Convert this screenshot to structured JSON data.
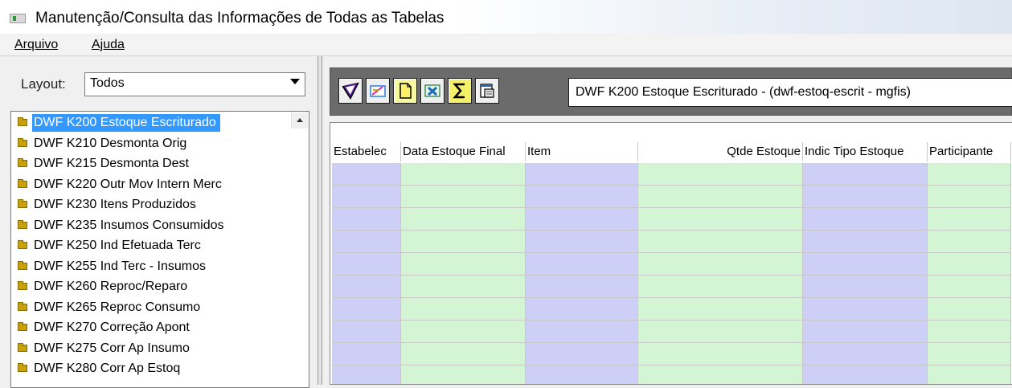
{
  "window": {
    "title": "Manutenção/Consulta das Informações de Todas as Tabelas"
  },
  "menu": {
    "items": [
      {
        "label": "Arquivo"
      },
      {
        "label": "Ajuda"
      }
    ]
  },
  "left": {
    "layout_label": "Layout:",
    "layout_value": "Todos",
    "tables": [
      {
        "label": "DWF K200 Estoque Escriturado",
        "selected": true
      },
      {
        "label": "DWF K210 Desmonta Orig"
      },
      {
        "label": "DWF K215 Desmonta Dest"
      },
      {
        "label": "DWF K220 Outr Mov Intern Merc"
      },
      {
        "label": "DWF K230 Itens Produzidos"
      },
      {
        "label": "DWF K235 Insumos Consumidos"
      },
      {
        "label": "DWF K250 Ind Efetuada Terc"
      },
      {
        "label": "DWF K255 Ind Terc - Insumos"
      },
      {
        "label": "DWF K260 Reproc/Reparo"
      },
      {
        "label": "DWF K265 Reproc Consumo"
      },
      {
        "label": "DWF K270 Correção Apont"
      },
      {
        "label": "DWF K275 Corr Ap Insumo"
      },
      {
        "label": "DWF K280 Corr Ap Estoq"
      }
    ]
  },
  "toolbar": {
    "icons": [
      "filter-icon",
      "edit-icon",
      "new-document-icon",
      "excel-export-icon",
      "sum-icon",
      "properties-icon"
    ],
    "view_name": "DWF K200 Estoque Escriturado - (dwf-estoq-escrit - mgfis)"
  },
  "grid": {
    "columns": [
      {
        "label": "Estabelec"
      },
      {
        "label": "Data Estoque Final"
      },
      {
        "label": "Item"
      },
      {
        "label": "Qtde Estoque"
      },
      {
        "label": "Indic Tipo Estoque"
      },
      {
        "label": "Participante"
      }
    ],
    "colors": {
      "purple": "#cecff7",
      "green": "#d4f5d4"
    }
  }
}
